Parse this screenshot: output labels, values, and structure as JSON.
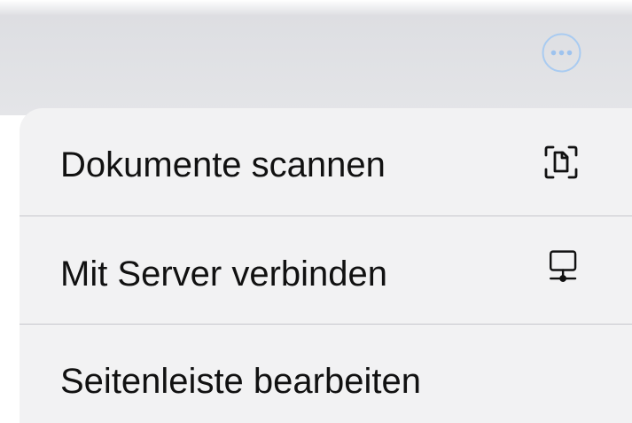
{
  "header": {
    "more_icon": "ellipsis-circle-icon",
    "accent_color": "#9ec3ee"
  },
  "menu": {
    "items": [
      {
        "label": "Dokumente scannen",
        "icon": "document-scan-icon"
      },
      {
        "label": "Mit Server verbinden",
        "icon": "server-display-icon"
      },
      {
        "label": "Seitenleiste bearbeiten",
        "icon": ""
      }
    ]
  }
}
